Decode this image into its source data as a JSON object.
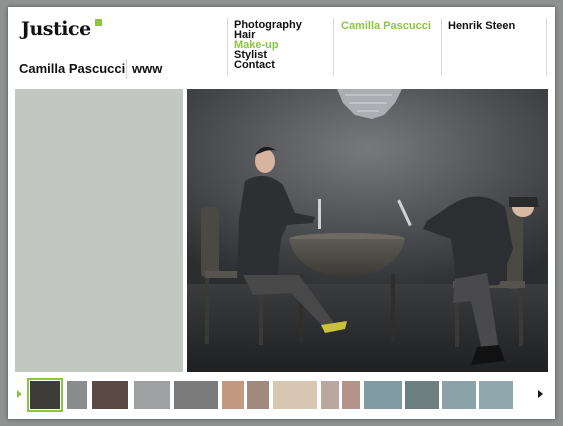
{
  "site": {
    "logo": "Justice",
    "accent_color": "#8cc63f"
  },
  "header": {
    "name": "Camilla Pascucci",
    "www": "www"
  },
  "nav": {
    "items": [
      {
        "label": "Photography",
        "active": false
      },
      {
        "label": "Hair",
        "active": false
      },
      {
        "label": "Make-up",
        "active": true
      },
      {
        "label": "Stylist",
        "active": false
      },
      {
        "label": "Contact",
        "active": false
      }
    ]
  },
  "artists": [
    {
      "label": "Camilla Pascucci",
      "active": true
    },
    {
      "label": "Henrik Steen",
      "active": false
    }
  ],
  "thumbnails": {
    "selected_index": 0,
    "prev_icon": "triangle-left-icon",
    "next_icon": "triangle-right-icon",
    "count": 16
  }
}
